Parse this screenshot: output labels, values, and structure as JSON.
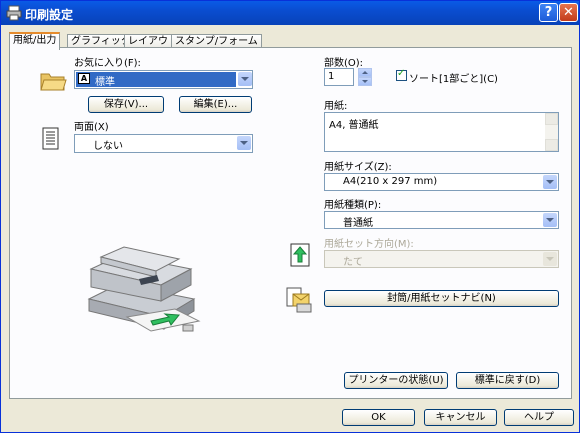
{
  "window": {
    "title": "印刷設定",
    "help_label": "?",
    "close_label": "✕"
  },
  "tabs": [
    {
      "label": "用紙/出力",
      "active": true
    },
    {
      "label": "グラフィックス",
      "active": false
    },
    {
      "label": "レイアウト",
      "active": false
    },
    {
      "label": "スタンプ/フォーム",
      "active": false
    }
  ],
  "favorites": {
    "label": "お気に入り(F):",
    "value": "標準",
    "save_label": "保存(V)...",
    "edit_label": "編集(E)..."
  },
  "duplex": {
    "label": "両面(X)",
    "value": "しない"
  },
  "copies": {
    "label": "部数(O):",
    "value": "1",
    "collate_label": "ソート[1部ごと](C)",
    "collate_checked": true
  },
  "paper": {
    "label": "用紙:",
    "value": "A4, 普通紙"
  },
  "paper_size": {
    "label": "用紙サイズ(Z):",
    "value": "A4(210 x 297 mm)"
  },
  "paper_type": {
    "label": "用紙種類(P):",
    "value": "普通紙"
  },
  "paper_orientation": {
    "label": "用紙セット方向(M):",
    "value": "たて",
    "enabled": false
  },
  "envelope_button": {
    "label": "封筒/用紙セットナビ(N)"
  },
  "printer_status_button": {
    "label": "プリンターの状態(U)"
  },
  "restore_defaults_button": {
    "label": "標準に戻す(D)"
  },
  "footer": {
    "ok_label": "OK",
    "cancel_label": "キャンセル",
    "help_label": "ヘルプ"
  },
  "colors": {
    "titlebar": "#0a4dd0",
    "tab_accent": "#e68b2c",
    "selection": "#316ac5",
    "dialog_bg": "#ece9d8"
  }
}
